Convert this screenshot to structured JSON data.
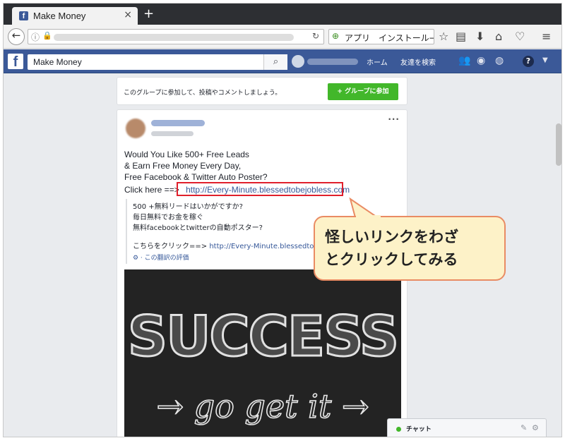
{
  "browser": {
    "tab_title": "Make Money",
    "tab_close": "×",
    "new_tab": "+",
    "search_text": "アプリ　インストール→",
    "icons": [
      "back-icon",
      "info-icon",
      "lock-icon",
      "reload-icon",
      "bookmark-star-icon",
      "reading-list-icon",
      "download-icon",
      "home-icon",
      "pocket-icon",
      "menu-icon"
    ]
  },
  "facebook": {
    "logo": "f",
    "search_value": "Make Money",
    "nav_home": "ホーム",
    "nav_find_friends": "友達を検索",
    "help": "?"
  },
  "group": {
    "join_prompt": "このグループに参加して、投稿やコメントしましょう。",
    "join_button": "+ グループに参加"
  },
  "post": {
    "more": "···",
    "line1": "Would You Like 500+ Free Leads",
    "line2": "& Earn Free Money Every Day,",
    "line3": "Free Facebook & Twitter Auto Poster?",
    "click_prefix": "Click here ==>",
    "link": "http://Every-Minute.blessedtobejobless.com",
    "translation": {
      "line1": "500 +無料リードはいかがですか?",
      "line2": "毎日無料でお金を稼ぐ",
      "line3": "無料facebookとtwitterの自動ポスター?",
      "line4_prefix": "こちらをクリック==>",
      "line4_link": "http://Every-Minute.blessedtobe",
      "rating": "この翻訳の評価"
    },
    "image_text_top": "SUCCESS",
    "image_text_bottom": "→ go get it →"
  },
  "chat": {
    "label": "チャット"
  },
  "callout": {
    "line1": "怪しいリンクをわざ",
    "line2": "とクリックしてみる"
  },
  "colors": {
    "facebook_blue": "#3b5998",
    "join_green": "#42b72a",
    "highlight_red": "#e0202c",
    "callout_fill": "#fdf2c8",
    "callout_border": "#e98b63"
  }
}
